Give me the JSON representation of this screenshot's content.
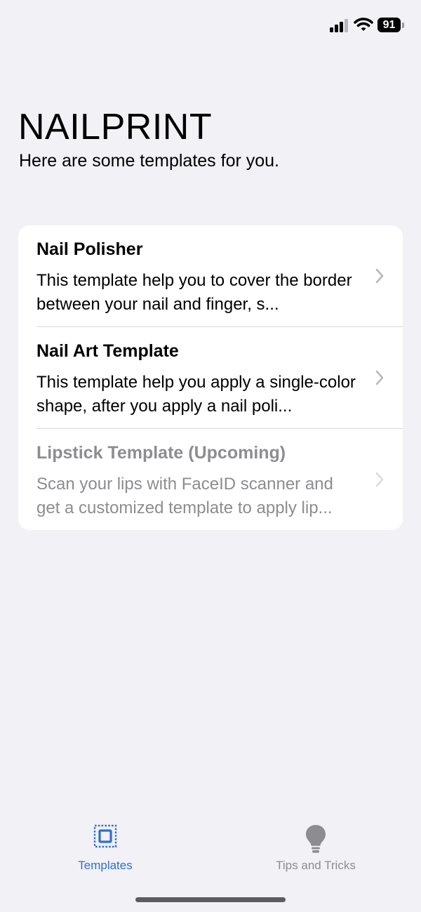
{
  "status_bar": {
    "battery": "91"
  },
  "header": {
    "title": "NAILPRINT",
    "subtitle": "Here are some templates for you."
  },
  "templates": [
    {
      "title": "Nail Polisher",
      "description": "This template help you to cover the border between your nail and finger, s...",
      "enabled": true
    },
    {
      "title": "Nail Art Template",
      "description": "This template help you apply a single-color shape, after you apply a nail poli...",
      "enabled": true
    },
    {
      "title": "Lipstick Template (Upcoming)",
      "description": "Scan your lips with FaceID scanner and get a customized template to apply lip...",
      "enabled": false
    }
  ],
  "tab_bar": {
    "tabs": [
      {
        "label": "Templates",
        "icon": "template-frame-icon",
        "selected": true
      },
      {
        "label": "Tips and Tricks",
        "icon": "lightbulb-icon",
        "selected": false
      }
    ]
  },
  "colors": {
    "accent": "#2f6fd0",
    "background": "#f1f1f6",
    "inactive_tab": "#8d8d91",
    "disabled_text": "#8d8d91"
  }
}
